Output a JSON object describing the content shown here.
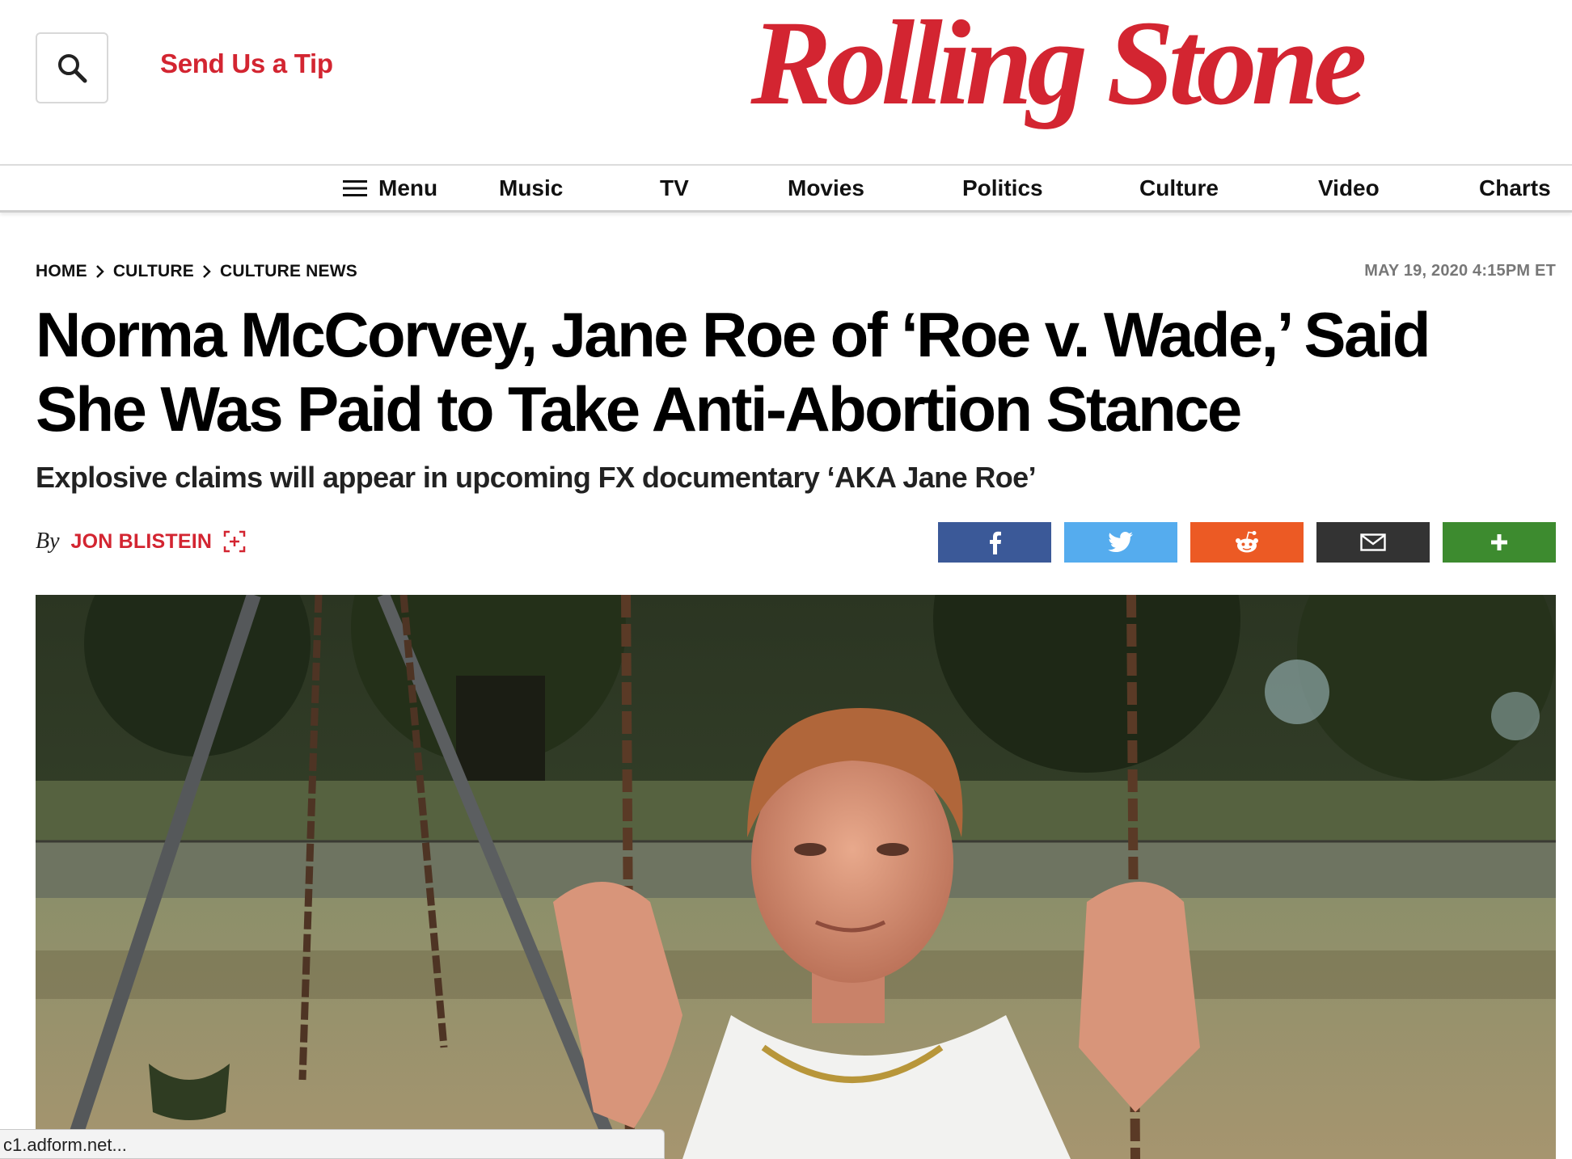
{
  "header": {
    "search_icon": "search-icon",
    "tip_label": "Send Us a Tip",
    "logo_text": "Rolling Stone",
    "brand_color": "#d32531"
  },
  "nav": {
    "menu_label": "Menu",
    "items": [
      "Music",
      "TV",
      "Movies",
      "Politics",
      "Culture",
      "Video",
      "Charts"
    ]
  },
  "article": {
    "breadcrumb": [
      "HOME",
      "CULTURE",
      "CULTURE NEWS"
    ],
    "date": "MAY 19, 2020 4:15PM ET",
    "headline_line1": "Norma McCorvey, Jane Roe of ‘Roe v. Wade,’ Said",
    "headline_line2": "She Was Paid to Take Anti-Abortion Stance",
    "subhead": "Explosive claims will appear in upcoming FX documentary ‘AKA Jane Roe’",
    "by_word": "By",
    "author": "JON BLISTEIN"
  },
  "share": [
    {
      "name": "facebook",
      "icon": "facebook-icon",
      "color": "#3b5998"
    },
    {
      "name": "twitter",
      "icon": "twitter-icon",
      "color": "#55acee"
    },
    {
      "name": "reddit",
      "icon": "reddit-icon",
      "color": "#ec5a24"
    },
    {
      "name": "email",
      "icon": "email-icon",
      "color": "#333333"
    },
    {
      "name": "more",
      "icon": "plus-icon",
      "color": "#3d8b2f"
    }
  ],
  "status_bar": {
    "text": "c1.adform.net..."
  }
}
